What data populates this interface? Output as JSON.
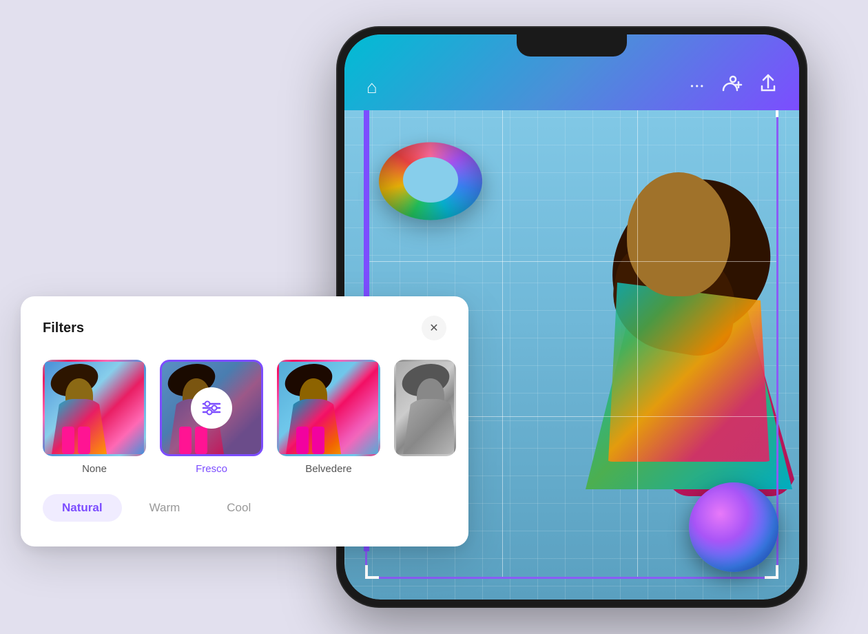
{
  "background_color": "#e8e6f0",
  "phone": {
    "header": {
      "home_icon": "⌂",
      "more_icon": "•••",
      "add_friends_icon": "👥",
      "share_icon": "↑"
    }
  },
  "filters_panel": {
    "title": "Filters",
    "close_label": "✕",
    "thumbnails": [
      {
        "id": "none",
        "label": "None",
        "selected": false
      },
      {
        "id": "fresco",
        "label": "Fresco",
        "selected": true
      },
      {
        "id": "belvedere",
        "label": "Belvedere",
        "selected": false
      },
      {
        "id": "fourth",
        "label": "",
        "selected": false
      }
    ],
    "tone_pills": [
      {
        "id": "natural",
        "label": "Natural",
        "active": true
      },
      {
        "id": "warm",
        "label": "Warm",
        "active": false
      },
      {
        "id": "cool",
        "label": "Cool",
        "active": false
      }
    ]
  }
}
